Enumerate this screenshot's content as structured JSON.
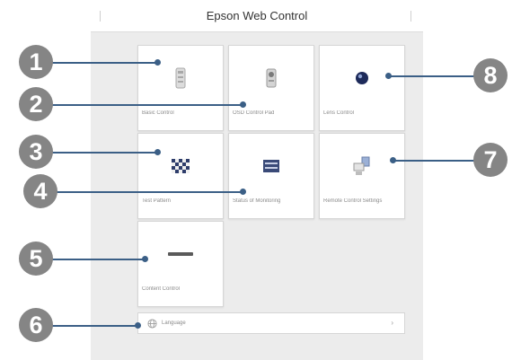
{
  "window": {
    "title": "Epson Web Control"
  },
  "tiles": [
    {
      "label": "Basic Control",
      "icon": "projector-remote-icon"
    },
    {
      "label": "OSD Control Pad",
      "icon": "remote-control-icon"
    },
    {
      "label": "Lens Control",
      "icon": "lens-icon"
    },
    {
      "label": "Test Pattern",
      "icon": "test-pattern-icon"
    },
    {
      "label": "Status of Monitoring",
      "icon": "status-monitor-icon"
    },
    {
      "label": "Remote Control Settings",
      "icon": "network-settings-icon"
    },
    {
      "label": "Content Control",
      "icon": "content-control-icon"
    }
  ],
  "language": {
    "label": "Language",
    "icon": "globe-icon",
    "chevron": "›"
  },
  "callouts": [
    "1",
    "2",
    "3",
    "4",
    "5",
    "6",
    "7",
    "8"
  ],
  "colors": {
    "callout_line": "#3b5f86",
    "badge": "#858585"
  }
}
